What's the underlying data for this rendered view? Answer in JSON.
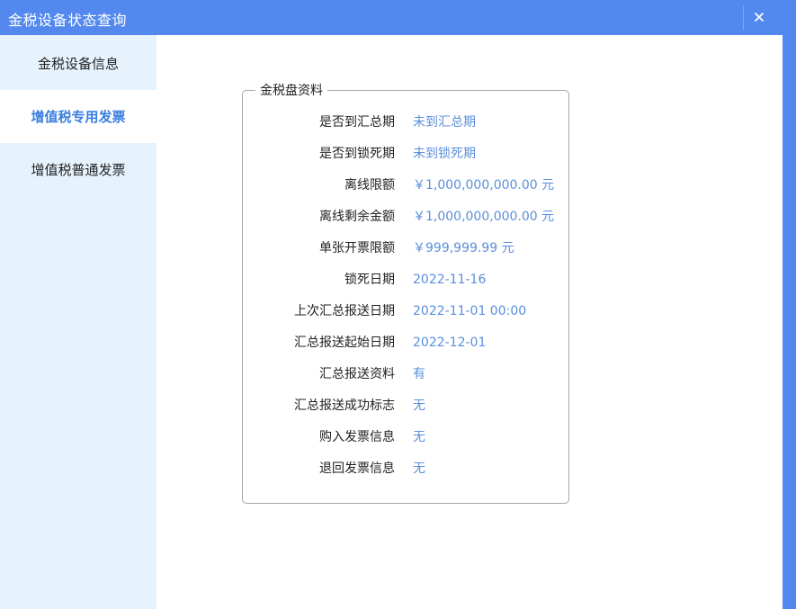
{
  "window": {
    "title": "金税设备状态查询",
    "close_icon": "close-icon",
    "colors": {
      "titlebar": "#5389ee",
      "sidebar": "#e6f3fd",
      "accent": "#3a7ee0",
      "value_text": "#5a8fdc"
    }
  },
  "sidebar": {
    "items": [
      {
        "label": "金税设备信息",
        "active": false
      },
      {
        "label": "增值税专用发票",
        "active": true
      },
      {
        "label": "增值税普通发票",
        "active": false
      }
    ]
  },
  "panel": {
    "legend": "金税盘资料",
    "rows": [
      {
        "label": "是否到汇总期",
        "value": "未到汇总期"
      },
      {
        "label": "是否到锁死期",
        "value": "未到锁死期"
      },
      {
        "label": "离线限额",
        "value": "￥1,000,000,000.00 元"
      },
      {
        "label": "离线剩余金额",
        "value": "￥1,000,000,000.00 元"
      },
      {
        "label": "单张开票限额",
        "value": "￥999,999.99 元"
      },
      {
        "label": "锁死日期",
        "value": "2022-11-16"
      },
      {
        "label": "上次汇总报送日期",
        "value": "2022-11-01 00:00"
      },
      {
        "label": "汇总报送起始日期",
        "value": "2022-12-01"
      },
      {
        "label": "汇总报送资料",
        "value": "有"
      },
      {
        "label": "汇总报送成功标志",
        "value": "无"
      },
      {
        "label": "购入发票信息",
        "value": "无"
      },
      {
        "label": "退回发票信息",
        "value": "无"
      }
    ]
  }
}
